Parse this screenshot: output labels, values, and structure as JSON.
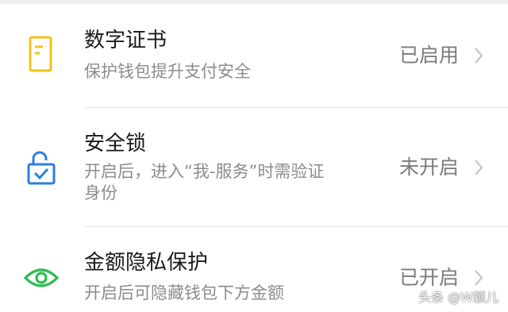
{
  "colors": {
    "certificate_icon": "#f2c21a",
    "lock_icon": "#2a7fe0",
    "eye_icon": "#2ebc54",
    "title_text": "#1a1a1a",
    "desc_text": "#8c8c8c",
    "status_text": "#7a7a7a",
    "chevron": "#c4c4c4"
  },
  "items": [
    {
      "title": "数字证书",
      "desc": "保护钱包提升支付安全",
      "status": "已启用",
      "icon": "certificate-icon"
    },
    {
      "title": "安全锁",
      "desc_line1": "开启后，进入“我-服务”时需验证",
      "desc_line2": "身份",
      "status": "未开启",
      "icon": "lock-icon"
    },
    {
      "title": "金额隐私保护",
      "desc": "开启后可隐藏钱包下方金额",
      "status": "已开启",
      "icon": "eye-icon"
    }
  ],
  "watermark": "头条 @W颖儿"
}
